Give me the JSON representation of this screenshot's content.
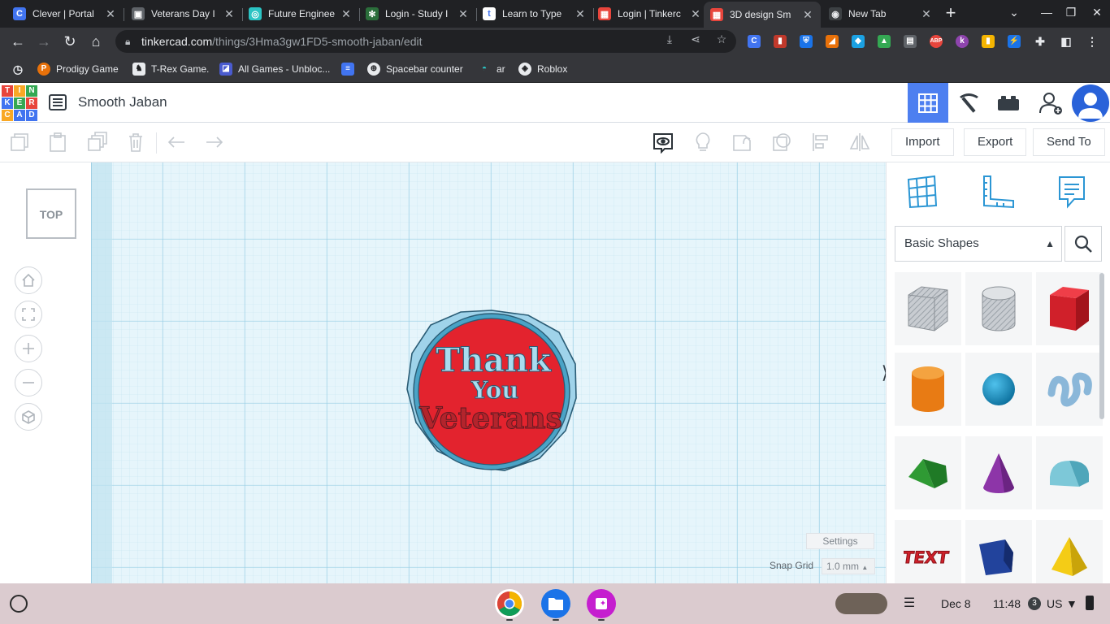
{
  "browser": {
    "tabs": [
      {
        "title": "Clever | Portal",
        "favicon": "C",
        "color": "#4174f0"
      },
      {
        "title": "Veterans Day I",
        "favicon": "▣",
        "color": "#5f6368"
      },
      {
        "title": "Future Enginee",
        "favicon": "◎",
        "color": "#2bc4c4"
      },
      {
        "title": "Login - Study I",
        "favicon": "✻",
        "color": "#34a853"
      },
      {
        "title": "Learn to Type",
        "favicon": "t",
        "color": "#ffffff"
      },
      {
        "title": "Login | Tinkerc",
        "favicon": "▦",
        "color": "#e8453c"
      },
      {
        "title": "3D design Sm",
        "favicon": "▦",
        "color": "#e8453c"
      },
      {
        "title": "New Tab",
        "favicon": "◉",
        "color": "#e8eaed"
      }
    ],
    "url_main": "tinkercad.com",
    "url_path": "/things/3Hma3gw1FD5-smooth-jaban/edit",
    "bookmarks": [
      {
        "label": "",
        "icon": "history-icon"
      },
      {
        "label": "Prodigy Game",
        "icon": "prodigy-icon"
      },
      {
        "label": "T-Rex Game.",
        "icon": "trex-icon"
      },
      {
        "label": "All Games - Unbloc...",
        "icon": "games-icon"
      },
      {
        "label": "",
        "icon": "docs-icon"
      },
      {
        "label": "Spacebar counter",
        "icon": "spacebar-icon"
      },
      {
        "label": "ar",
        "icon": "ar-icon"
      },
      {
        "label": "Roblox",
        "icon": "roblox-icon"
      }
    ]
  },
  "tinkercad": {
    "logo_letters": [
      "T",
      "I",
      "N",
      "K",
      "E",
      "R",
      "C",
      "A",
      "D"
    ],
    "design_name": "Smooth Jaban",
    "toolbar": {
      "import_label": "Import",
      "export_label": "Export",
      "send_to_label": "Send To"
    },
    "viewcube_label": "TOP",
    "model_text": {
      "line1": "Thank",
      "line2": "You",
      "line3": "Veterans"
    },
    "settings_label": "Settings",
    "snap_grid_label": "Snap Grid",
    "snap_grid_value": "1.0 mm",
    "shapes_category": "Basic Shapes",
    "shapes": [
      "box-hole",
      "cylinder-hole",
      "box",
      "cylinder",
      "sphere",
      "scribble",
      "roof",
      "cone",
      "round-roof",
      "text",
      "prism",
      "pyramid"
    ],
    "text_shape_label": "TEXT"
  },
  "shelf": {
    "date": "Dec 8",
    "time": "11:48",
    "notification_count": "3",
    "locale": "US"
  }
}
